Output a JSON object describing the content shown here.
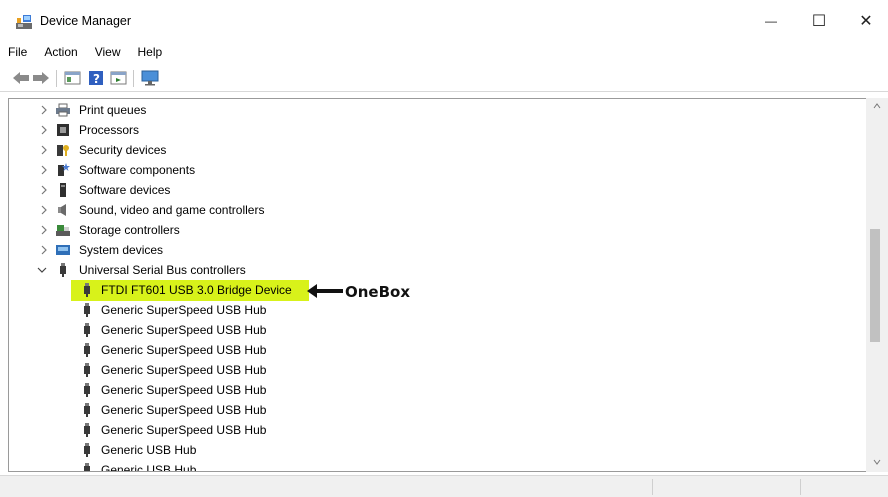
{
  "window": {
    "title": "Device Manager",
    "minimize_glyph": "—",
    "maximize_glyph": "☐",
    "close_glyph": "✕"
  },
  "menu": [
    "File",
    "Action",
    "View",
    "Help"
  ],
  "toolbar": {
    "icons": [
      "back-arrow-icon",
      "forward-arrow-icon",
      "properties-icon",
      "help-icon",
      "update-driver-icon",
      "monitor-icon"
    ]
  },
  "tree": {
    "categories": [
      {
        "label": "Print queues",
        "icon": "printer-icon",
        "state": "collapsed"
      },
      {
        "label": "Processors",
        "icon": "processor-icon",
        "state": "collapsed"
      },
      {
        "label": "Security devices",
        "icon": "security-device-icon",
        "state": "collapsed"
      },
      {
        "label": "Software components",
        "icon": "software-component-icon",
        "state": "collapsed"
      },
      {
        "label": "Software devices",
        "icon": "software-device-icon",
        "state": "collapsed"
      },
      {
        "label": "Sound, video and game controllers",
        "icon": "speaker-icon",
        "state": "collapsed"
      },
      {
        "label": "Storage controllers",
        "icon": "storage-controller-icon",
        "state": "collapsed"
      },
      {
        "label": "System devices",
        "icon": "system-device-icon",
        "state": "collapsed"
      },
      {
        "label": "Universal Serial Bus controllers",
        "icon": "usb-plug-icon",
        "state": "expanded"
      }
    ],
    "usb_children": [
      {
        "label": "FTDI FT601 USB 3.0 Bridge Device",
        "highlighted": true
      },
      {
        "label": "Generic SuperSpeed USB Hub"
      },
      {
        "label": "Generic SuperSpeed USB Hub"
      },
      {
        "label": "Generic SuperSpeed USB Hub"
      },
      {
        "label": "Generic SuperSpeed USB Hub"
      },
      {
        "label": "Generic SuperSpeed USB Hub"
      },
      {
        "label": "Generic SuperSpeed USB Hub"
      },
      {
        "label": "Generic SuperSpeed USB Hub"
      },
      {
        "label": "Generic USB Hub"
      },
      {
        "label": "Generic USB Hub"
      }
    ]
  },
  "annotation": {
    "text": "OneBox"
  },
  "colors": {
    "highlight": "#d8f21a",
    "border": "#9a9a9a",
    "scroll_thumb": "#c1c1c1"
  }
}
